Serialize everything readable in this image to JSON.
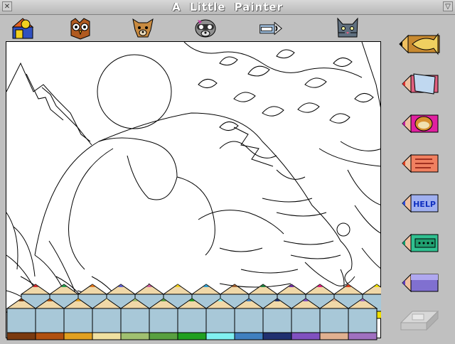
{
  "window": {
    "title": "A Little Painter",
    "close_glyph": "✕",
    "collapse_glyph": "▽"
  },
  "toolbar": [
    {
      "name": "house-sun-icon"
    },
    {
      "name": "owl-icon"
    },
    {
      "name": "dog-icon"
    },
    {
      "name": "raccoon-icon"
    },
    {
      "name": "tape-measure-icon"
    },
    {
      "name": "cat-icon"
    }
  ],
  "sidebar": [
    {
      "name": "trumpet-pencil-icon"
    },
    {
      "name": "notebook-pencil-icon"
    },
    {
      "name": "cookie-pencil-icon"
    },
    {
      "name": "hand-pencil-icon"
    },
    {
      "name": "help-pencil-icon",
      "label": "HELP"
    },
    {
      "name": "dots-pencil-icon"
    },
    {
      "name": "blank-pencil-icon"
    },
    {
      "name": "eraser-icon"
    }
  ],
  "palette": {
    "top_row": [
      "#d43030",
      "#28a050",
      "#e07820",
      "#6060d0",
      "#d060a0",
      "#f0d020",
      "#30a0d0",
      "#a06030",
      "#208040",
      "#7030a0",
      "#e02080",
      "#e04020",
      "#f0e000"
    ],
    "bottom_row": [
      "#7a3a10",
      "#b05010",
      "#e0a020",
      "#f0e0a0",
      "#a0c070",
      "#58a040",
      "#20a020",
      "#80f0f0",
      "#4080c0",
      "#203070",
      "#8050c0",
      "#e0b090",
      "#a070c0"
    ]
  }
}
